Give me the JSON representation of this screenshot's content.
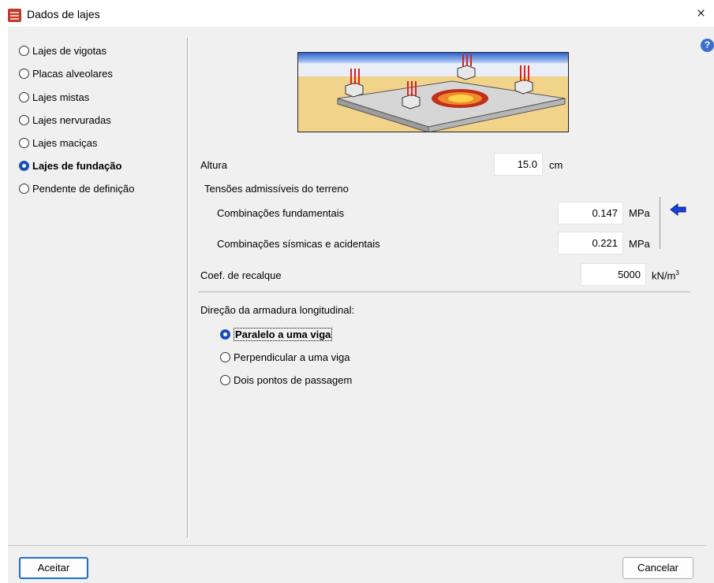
{
  "window": {
    "title": "Dados de lajes",
    "close_glyph": "×",
    "help_glyph": "?"
  },
  "slab_types": [
    {
      "label": "Lajes de vigotas",
      "checked": false
    },
    {
      "label": "Placas alveolares",
      "checked": false
    },
    {
      "label": "Lajes mistas",
      "checked": false
    },
    {
      "label": "Lajes nervuradas",
      "checked": false
    },
    {
      "label": "Lajes maciças",
      "checked": false
    },
    {
      "label": "Lajes de fundação",
      "checked": true
    },
    {
      "label": "Pendente de definição",
      "checked": false
    }
  ],
  "form": {
    "height": {
      "label": "Altura",
      "value": "15.0",
      "unit": "cm"
    },
    "soil_stress": {
      "heading": "Tensões admissíveis do terreno",
      "fundamental": {
        "label": "Combinações fundamentais",
        "value": "0.147",
        "unit": "MPa"
      },
      "seismic": {
        "label": "Combinações sísmicas e acidentais",
        "value": "0.221",
        "unit": "MPa"
      }
    },
    "subgrade": {
      "label": "Coef. de recalque",
      "value": "5000",
      "unit": "kN/m",
      "unit_sup": "3"
    },
    "reinforcement": {
      "heading": "Direção da armadura longitudinal:",
      "options": [
        {
          "label": "Paralelo a uma viga",
          "checked": true
        },
        {
          "label": "Perpendicular a uma viga",
          "checked": false
        },
        {
          "label": "Dois pontos de passagem",
          "checked": false
        }
      ]
    }
  },
  "buttons": {
    "accept": "Aceitar",
    "cancel": "Cancelar"
  },
  "icons": {
    "title": "app-slab-icon",
    "arrow": "arrow-left-icon",
    "help": "help-icon"
  },
  "colors": {
    "accent": "#1b4fb8",
    "arrow": "#1a3fd6",
    "sky": "#2f6bd6",
    "sand": "#f2d38a",
    "load": "#e02020"
  }
}
